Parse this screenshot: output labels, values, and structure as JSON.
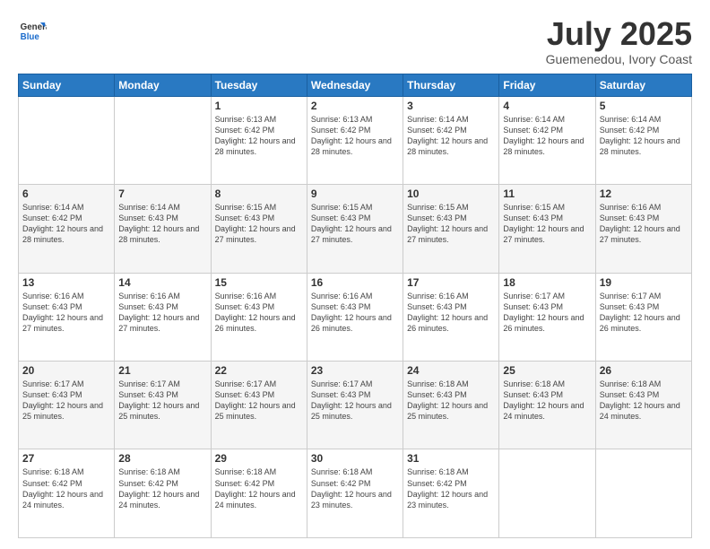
{
  "logo": {
    "general": "General",
    "blue": "Blue"
  },
  "header": {
    "month": "July 2025",
    "location": "Guemenedou, Ivory Coast"
  },
  "weekdays": [
    "Sunday",
    "Monday",
    "Tuesday",
    "Wednesday",
    "Thursday",
    "Friday",
    "Saturday"
  ],
  "weeks": [
    [
      {
        "day": "",
        "info": ""
      },
      {
        "day": "",
        "info": ""
      },
      {
        "day": "1",
        "info": "Sunrise: 6:13 AM\nSunset: 6:42 PM\nDaylight: 12 hours and 28 minutes."
      },
      {
        "day": "2",
        "info": "Sunrise: 6:13 AM\nSunset: 6:42 PM\nDaylight: 12 hours and 28 minutes."
      },
      {
        "day": "3",
        "info": "Sunrise: 6:14 AM\nSunset: 6:42 PM\nDaylight: 12 hours and 28 minutes."
      },
      {
        "day": "4",
        "info": "Sunrise: 6:14 AM\nSunset: 6:42 PM\nDaylight: 12 hours and 28 minutes."
      },
      {
        "day": "5",
        "info": "Sunrise: 6:14 AM\nSunset: 6:42 PM\nDaylight: 12 hours and 28 minutes."
      }
    ],
    [
      {
        "day": "6",
        "info": "Sunrise: 6:14 AM\nSunset: 6:42 PM\nDaylight: 12 hours and 28 minutes."
      },
      {
        "day": "7",
        "info": "Sunrise: 6:14 AM\nSunset: 6:43 PM\nDaylight: 12 hours and 28 minutes."
      },
      {
        "day": "8",
        "info": "Sunrise: 6:15 AM\nSunset: 6:43 PM\nDaylight: 12 hours and 27 minutes."
      },
      {
        "day": "9",
        "info": "Sunrise: 6:15 AM\nSunset: 6:43 PM\nDaylight: 12 hours and 27 minutes."
      },
      {
        "day": "10",
        "info": "Sunrise: 6:15 AM\nSunset: 6:43 PM\nDaylight: 12 hours and 27 minutes."
      },
      {
        "day": "11",
        "info": "Sunrise: 6:15 AM\nSunset: 6:43 PM\nDaylight: 12 hours and 27 minutes."
      },
      {
        "day": "12",
        "info": "Sunrise: 6:16 AM\nSunset: 6:43 PM\nDaylight: 12 hours and 27 minutes."
      }
    ],
    [
      {
        "day": "13",
        "info": "Sunrise: 6:16 AM\nSunset: 6:43 PM\nDaylight: 12 hours and 27 minutes."
      },
      {
        "day": "14",
        "info": "Sunrise: 6:16 AM\nSunset: 6:43 PM\nDaylight: 12 hours and 27 minutes."
      },
      {
        "day": "15",
        "info": "Sunrise: 6:16 AM\nSunset: 6:43 PM\nDaylight: 12 hours and 26 minutes."
      },
      {
        "day": "16",
        "info": "Sunrise: 6:16 AM\nSunset: 6:43 PM\nDaylight: 12 hours and 26 minutes."
      },
      {
        "day": "17",
        "info": "Sunrise: 6:16 AM\nSunset: 6:43 PM\nDaylight: 12 hours and 26 minutes."
      },
      {
        "day": "18",
        "info": "Sunrise: 6:17 AM\nSunset: 6:43 PM\nDaylight: 12 hours and 26 minutes."
      },
      {
        "day": "19",
        "info": "Sunrise: 6:17 AM\nSunset: 6:43 PM\nDaylight: 12 hours and 26 minutes."
      }
    ],
    [
      {
        "day": "20",
        "info": "Sunrise: 6:17 AM\nSunset: 6:43 PM\nDaylight: 12 hours and 25 minutes."
      },
      {
        "day": "21",
        "info": "Sunrise: 6:17 AM\nSunset: 6:43 PM\nDaylight: 12 hours and 25 minutes."
      },
      {
        "day": "22",
        "info": "Sunrise: 6:17 AM\nSunset: 6:43 PM\nDaylight: 12 hours and 25 minutes."
      },
      {
        "day": "23",
        "info": "Sunrise: 6:17 AM\nSunset: 6:43 PM\nDaylight: 12 hours and 25 minutes."
      },
      {
        "day": "24",
        "info": "Sunrise: 6:18 AM\nSunset: 6:43 PM\nDaylight: 12 hours and 25 minutes."
      },
      {
        "day": "25",
        "info": "Sunrise: 6:18 AM\nSunset: 6:43 PM\nDaylight: 12 hours and 24 minutes."
      },
      {
        "day": "26",
        "info": "Sunrise: 6:18 AM\nSunset: 6:43 PM\nDaylight: 12 hours and 24 minutes."
      }
    ],
    [
      {
        "day": "27",
        "info": "Sunrise: 6:18 AM\nSunset: 6:42 PM\nDaylight: 12 hours and 24 minutes."
      },
      {
        "day": "28",
        "info": "Sunrise: 6:18 AM\nSunset: 6:42 PM\nDaylight: 12 hours and 24 minutes."
      },
      {
        "day": "29",
        "info": "Sunrise: 6:18 AM\nSunset: 6:42 PM\nDaylight: 12 hours and 24 minutes."
      },
      {
        "day": "30",
        "info": "Sunrise: 6:18 AM\nSunset: 6:42 PM\nDaylight: 12 hours and 23 minutes."
      },
      {
        "day": "31",
        "info": "Sunrise: 6:18 AM\nSunset: 6:42 PM\nDaylight: 12 hours and 23 minutes."
      },
      {
        "day": "",
        "info": ""
      },
      {
        "day": "",
        "info": ""
      }
    ]
  ]
}
